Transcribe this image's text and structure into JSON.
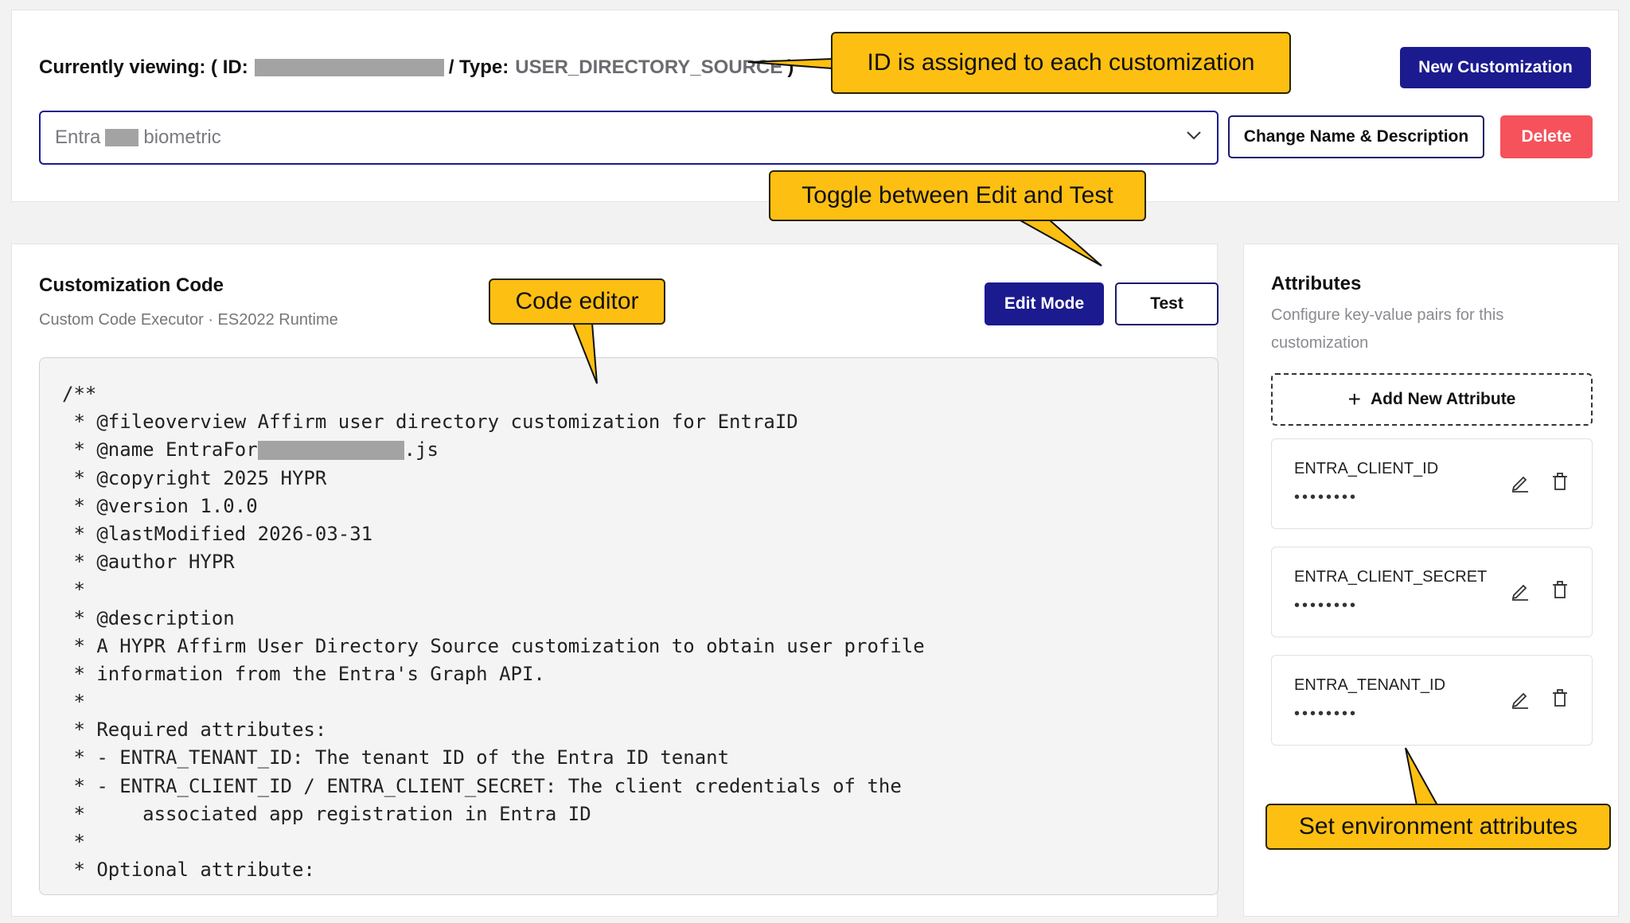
{
  "header": {
    "viewing_prefix": "Currently viewing: ( ID:",
    "type_label": "/ Type:",
    "type_value": "USER_DIRECTORY_SOURCE",
    "close_paren": ")",
    "new_customization_label": "New Customization"
  },
  "selector": {
    "selected_prefix": "Entra",
    "selected_suffix": "biometric",
    "change_name_label": "Change Name & Description",
    "delete_label": "Delete"
  },
  "code_section": {
    "title": "Customization Code",
    "subtitle": "Custom Code Executor · ES2022 Runtime",
    "edit_mode_label": "Edit Mode",
    "test_label": "Test",
    "lines": [
      "/**",
      " * @fileoverview Affirm user directory customization for EntraID",
      " * @name EntraFor",
      " * @copyright 2025 HYPR",
      " * @version 1.0.0",
      " * @lastModified 2026-03-31",
      " * @author HYPR",
      " *",
      " * @description",
      " * A HYPR Affirm User Directory Source customization to obtain user profile",
      " * information from the Entra's Graph API.",
      " *",
      " * Required attributes:",
      " * - ENTRA_TENANT_ID: The tenant ID of the Entra ID tenant",
      " * - ENTRA_CLIENT_ID / ENTRA_CLIENT_SECRET: The client credentials of the",
      " *     associated app registration in Entra ID",
      " *",
      " * Optional attribute:"
    ],
    "line2_suffix": ".js"
  },
  "attributes": {
    "title": "Attributes",
    "description": "Configure key-value pairs for this customization",
    "add_label": "Add New Attribute",
    "items": [
      {
        "name": "ENTRA_CLIENT_ID",
        "value": "••••••••"
      },
      {
        "name": "ENTRA_CLIENT_SECRET",
        "value": "••••••••"
      },
      {
        "name": "ENTRA_TENANT_ID",
        "value": "••••••••"
      }
    ]
  },
  "callouts": {
    "id": "ID is assigned to each customization",
    "toggle": "Toggle between Edit and Test",
    "code": "Code editor",
    "env": "Set environment attributes"
  },
  "colors": {
    "primary": "#1b1a8f",
    "danger": "#f5525c",
    "callout": "#fdbf12"
  }
}
